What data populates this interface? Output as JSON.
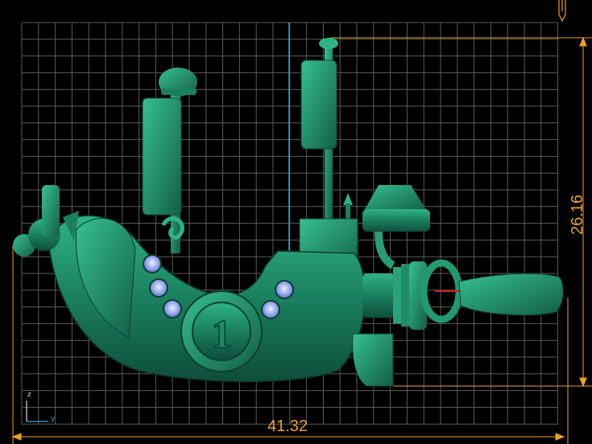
{
  "viewport": {
    "background": "#000000",
    "grid_color": "#6a6a6a",
    "dimension_color": "#f0a020",
    "accent_line_color": "#3aa0d0",
    "model_color": "#1e8a68"
  },
  "dimensions": {
    "width_value": "41.32",
    "height_value": "26.16"
  },
  "axes": {
    "vertical": "z",
    "horizontal": "y"
  },
  "model": {
    "badge_number": "1"
  },
  "icons": {
    "corner_marker": "pin-marker-icon",
    "axis_triad": "axis-triad-icon"
  }
}
